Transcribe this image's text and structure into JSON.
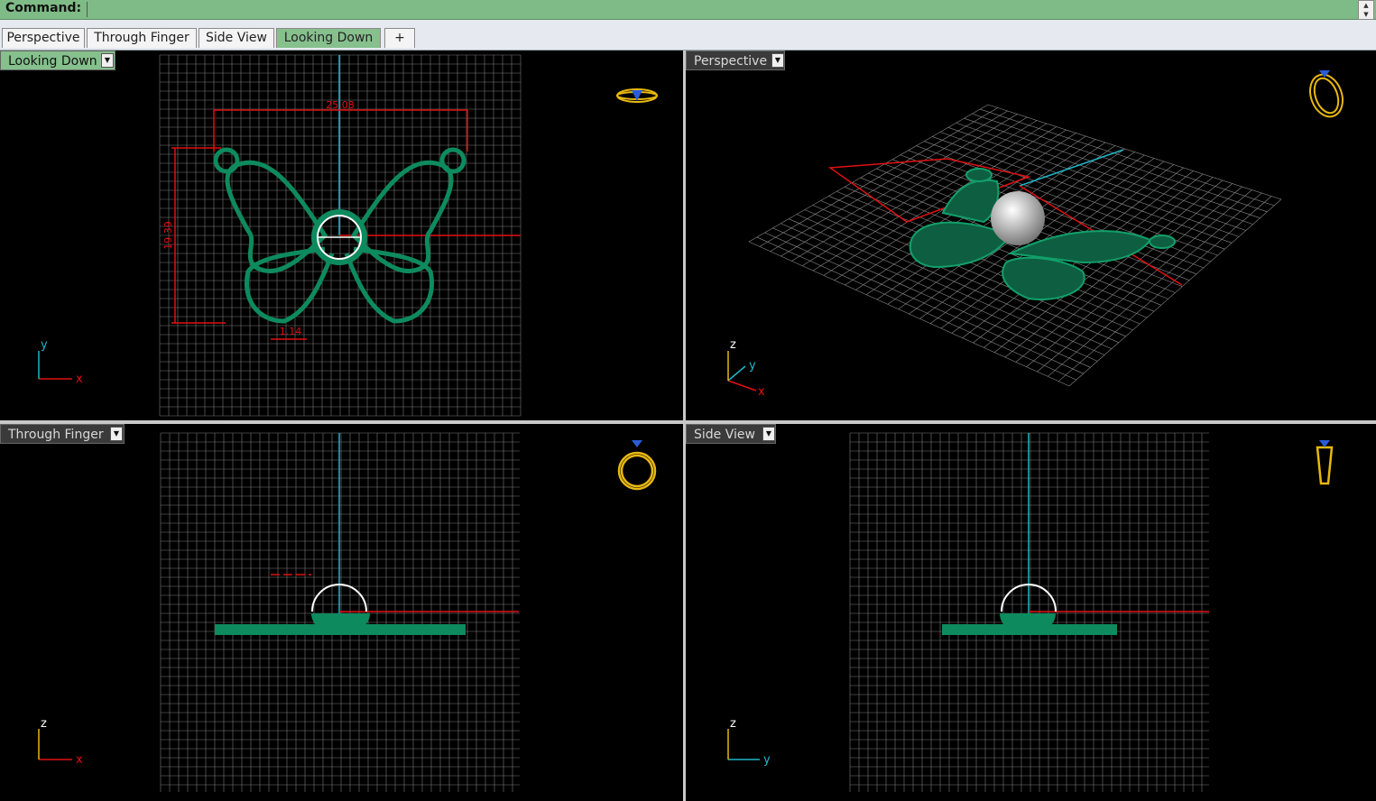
{
  "command": {
    "label": "Command:",
    "value": ""
  },
  "tabs": [
    {
      "label": "Perspective",
      "active": false
    },
    {
      "label": "Through Finger",
      "active": false
    },
    {
      "label": "Side View",
      "active": false
    },
    {
      "label": "Looking Down",
      "active": true
    },
    {
      "label": "+",
      "active": false
    }
  ],
  "viewports": {
    "top_left": {
      "name": "Looking Down",
      "active": true,
      "axis_h": "x",
      "axis_v": "y",
      "dim_width": "25.08",
      "dim_height": "19.39",
      "dim_small": "1.14"
    },
    "top_right": {
      "name": "Perspective",
      "active": false,
      "axis_x": "x",
      "axis_y": "y",
      "axis_z": "z"
    },
    "bottom_left": {
      "name": "Through Finger",
      "active": false,
      "axis_h": "x",
      "axis_v": "z"
    },
    "bottom_right": {
      "name": "Side View",
      "active": false,
      "axis_h": "y",
      "axis_v": "z"
    }
  },
  "colors": {
    "object": "#0e8a5f",
    "grid": "#8a8a8a",
    "red_axis": "#e01010",
    "green_axis": "#1fb6c8",
    "ring_icon": "#e8b810",
    "active_tab": "#86c08d"
  }
}
